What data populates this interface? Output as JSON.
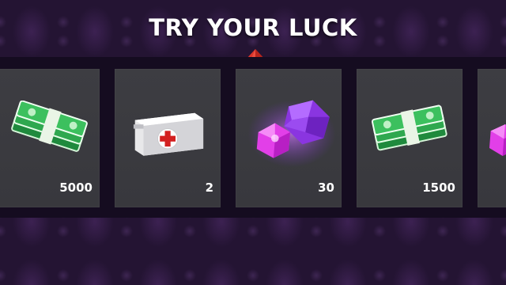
{
  "title": "TRY YOUR LUCK",
  "pointer_icon": "red-gem-pointer",
  "items": [
    {
      "reward": "cash",
      "icon": "cash-stack-icon",
      "amount": "5000"
    },
    {
      "reward": "first-aid-kit",
      "icon": "first-aid-kit-icon",
      "amount": "2"
    },
    {
      "reward": "gems",
      "icon": "purple-gems-icon",
      "amount": "30"
    },
    {
      "reward": "cash",
      "icon": "cash-stack-icon",
      "amount": "1500"
    },
    {
      "reward": "gems",
      "icon": "purple-gems-icon",
      "amount": ""
    }
  ],
  "colors": {
    "background": "#241433",
    "strip": "#150c20",
    "card": "#3b3b40",
    "pointer": "#d9342b",
    "cash": "#2fa84f",
    "gem": "#a64dff"
  }
}
